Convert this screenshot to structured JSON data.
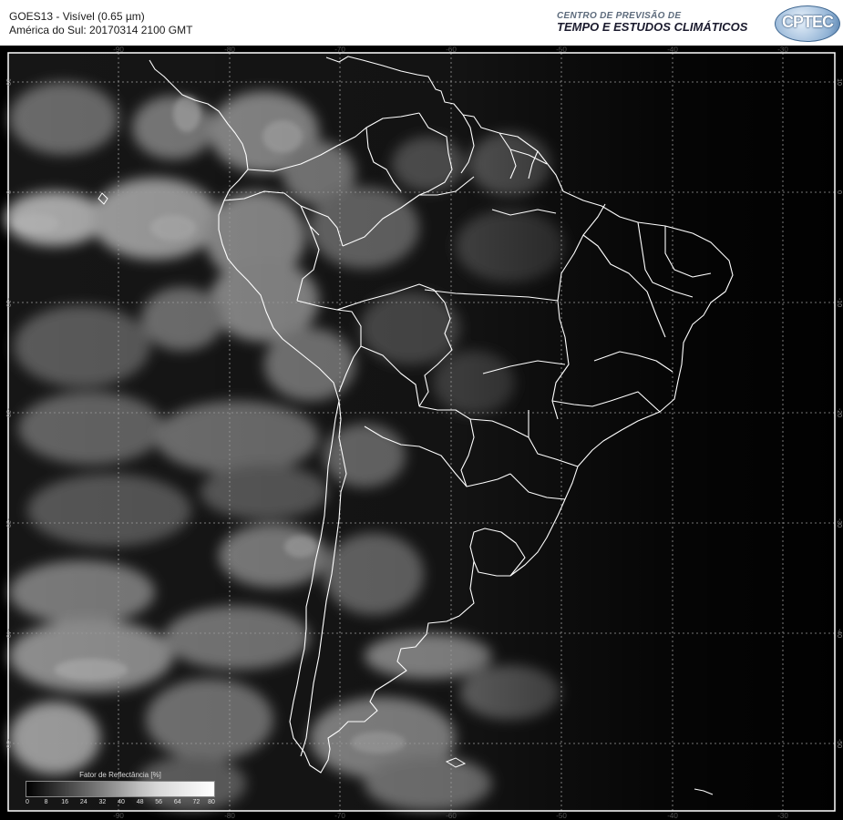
{
  "header": {
    "title_line1": "GOES13 - Visível (0.65 µm)",
    "title_line2": "América do Sul: 20170314 2100 GMT",
    "org_line1": "CENTRO DE PREVISÃO DE",
    "org_line2": "TEMPO E ESTUDOS CLIMÁTICOS",
    "logo_text": "CPTEC"
  },
  "map": {
    "lon_ticks": [
      "-90",
      "-80",
      "-70",
      "-60",
      "-50",
      "-40",
      "-30"
    ],
    "lat_ticks": [
      "10",
      "0",
      "-10",
      "-20",
      "-30",
      "-40",
      "-50"
    ],
    "grid_color": "#9a9a9a",
    "border_color": "#ffffff"
  },
  "colorbar": {
    "title": "Fator de Reflectância [%]",
    "ticks": [
      "0",
      "8",
      "16",
      "24",
      "32",
      "40",
      "48",
      "56",
      "64",
      "72",
      "80"
    ]
  }
}
